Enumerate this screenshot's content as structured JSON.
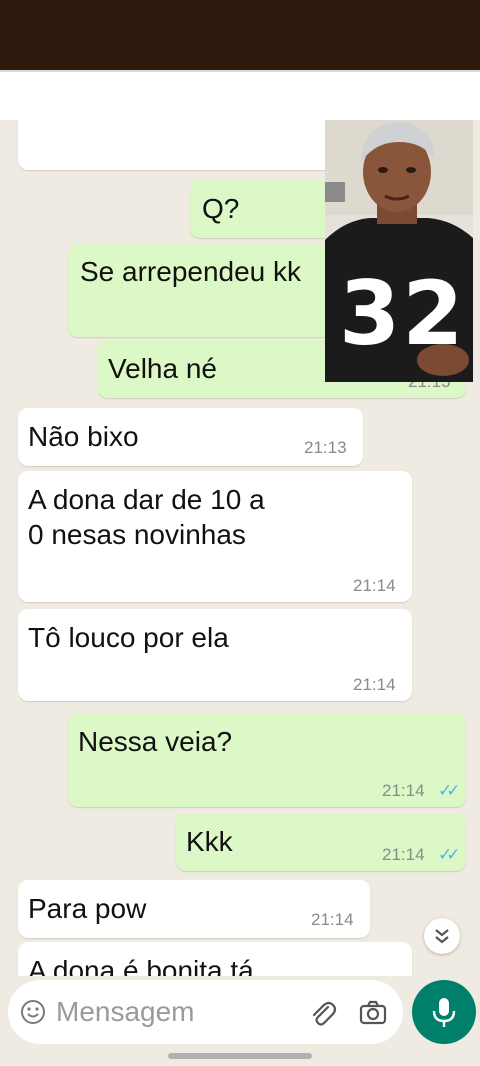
{
  "messages": [
    {
      "dir": "in",
      "text": ".",
      "time": "",
      "read": false
    },
    {
      "dir": "out",
      "text": "Q?",
      "time": "",
      "read": true
    },
    {
      "dir": "out",
      "text": "Se arrependeu kk",
      "time": "",
      "read": false
    },
    {
      "dir": "out",
      "text": "Velha né",
      "time": "21:13",
      "read": false
    },
    {
      "dir": "in",
      "text": "Não bixo",
      "time": "21:13"
    },
    {
      "dir": "in",
      "text_lines": [
        "A dona dar de 10 a",
        "0 nesas novinhas"
      ],
      "time": "21:14"
    },
    {
      "dir": "in",
      "text": "Tô louco por ela",
      "time": "21:14"
    },
    {
      "dir": "out",
      "text": "Nessa veia?",
      "time": "21:14",
      "read": true
    },
    {
      "dir": "out",
      "text": "Kkk",
      "time": "21:14",
      "read": true
    },
    {
      "dir": "in",
      "text": "Para pow",
      "time": "21:14"
    },
    {
      "dir": "in",
      "text": "A dona é bonita tá",
      "time": ""
    }
  ],
  "input": {
    "placeholder": "Mensagem"
  },
  "video_overlay": {
    "jersey_number": "32"
  },
  "icons": {
    "emoji": "emoji-icon",
    "attach": "paperclip-icon",
    "camera": "camera-icon",
    "mic": "mic-icon",
    "scroll_down": "double-chevron-down-icon",
    "read_ticks": "double-check-icon"
  },
  "colors": {
    "chat_background": "#efeae2",
    "outgoing_bubble": "#dcf8c6",
    "incoming_bubble": "#ffffff",
    "mic_button": "#00806b",
    "read_ticks": "#4fb6ec",
    "top_bar": "#2e1a0c"
  }
}
